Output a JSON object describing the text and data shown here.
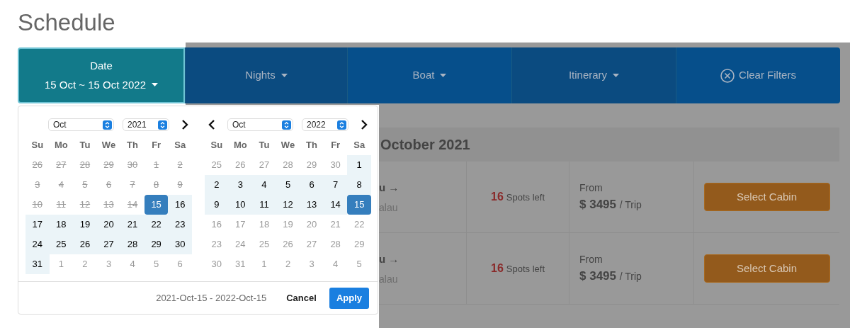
{
  "page_title": "Schedule",
  "filters": [
    {
      "kind": "date",
      "label": "Date",
      "value": "15 Oct ~ 15 Oct 2022",
      "selected": true
    },
    {
      "kind": "dropdown",
      "label": "Nights",
      "selected": false
    },
    {
      "kind": "dropdown",
      "label": "Boat",
      "selected": false
    },
    {
      "kind": "dropdown",
      "label": "Itinerary",
      "selected": false
    },
    {
      "kind": "clear",
      "label": "Clear Filters",
      "selected": false
    }
  ],
  "month_heading": "October 2021",
  "trips": [
    {
      "route_end": "u →",
      "port": "alau",
      "spots_count": "16",
      "spots_label": "Spots left",
      "from_label": "From",
      "price": "$ 3495",
      "price_unit": "/ Trip",
      "action": "Select Cabin"
    },
    {
      "route_end": "u →",
      "port": "alau",
      "spots_count": "16",
      "spots_label": "Spots left",
      "from_label": "From",
      "price": "$ 3495",
      "price_unit": "/ Trip",
      "action": "Select Cabin"
    }
  ],
  "calendars": [
    {
      "month": "Oct",
      "year": "2021",
      "prev": false,
      "next": true,
      "weekdays": [
        "Su",
        "Mo",
        "Tu",
        "We",
        "Th",
        "Fr",
        "Sa"
      ],
      "days": [
        {
          "day": "26",
          "kind": "disabled"
        },
        {
          "day": "27",
          "kind": "disabled"
        },
        {
          "day": "28",
          "kind": "disabled"
        },
        {
          "day": "29",
          "kind": "disabled"
        },
        {
          "day": "30",
          "kind": "disabled"
        },
        {
          "day": "1",
          "kind": "disabled"
        },
        {
          "day": "2",
          "kind": "disabled"
        },
        {
          "day": "3",
          "kind": "disabled"
        },
        {
          "day": "4",
          "kind": "disabled"
        },
        {
          "day": "5",
          "kind": "disabled"
        },
        {
          "day": "6",
          "kind": "disabled"
        },
        {
          "day": "7",
          "kind": "disabled"
        },
        {
          "day": "8",
          "kind": "disabled"
        },
        {
          "day": "9",
          "kind": "disabled"
        },
        {
          "day": "10",
          "kind": "disabled"
        },
        {
          "day": "11",
          "kind": "disabled"
        },
        {
          "day": "12",
          "kind": "disabled"
        },
        {
          "day": "13",
          "kind": "disabled"
        },
        {
          "day": "14",
          "kind": "disabled"
        },
        {
          "day": "15",
          "kind": "selected"
        },
        {
          "day": "16",
          "kind": "in_range"
        },
        {
          "day": "17",
          "kind": "in_range"
        },
        {
          "day": "18",
          "kind": "in_range"
        },
        {
          "day": "19",
          "kind": "in_range"
        },
        {
          "day": "20",
          "kind": "in_range"
        },
        {
          "day": "21",
          "kind": "in_range"
        },
        {
          "day": "22",
          "kind": "in_range"
        },
        {
          "day": "23",
          "kind": "in_range"
        },
        {
          "day": "24",
          "kind": "in_range"
        },
        {
          "day": "25",
          "kind": "in_range"
        },
        {
          "day": "26",
          "kind": "in_range"
        },
        {
          "day": "27",
          "kind": "in_range"
        },
        {
          "day": "28",
          "kind": "in_range"
        },
        {
          "day": "29",
          "kind": "in_range"
        },
        {
          "day": "30",
          "kind": "in_range"
        },
        {
          "day": "31",
          "kind": "in_range"
        },
        {
          "day": "1",
          "kind": "off"
        },
        {
          "day": "2",
          "kind": "off"
        },
        {
          "day": "3",
          "kind": "off"
        },
        {
          "day": "4",
          "kind": "off"
        },
        {
          "day": "5",
          "kind": "off"
        },
        {
          "day": "6",
          "kind": "off"
        }
      ]
    },
    {
      "month": "Oct",
      "year": "2022",
      "prev": true,
      "next": true,
      "weekdays": [
        "Su",
        "Mo",
        "Tu",
        "We",
        "Th",
        "Fr",
        "Sa"
      ],
      "days": [
        {
          "day": "25",
          "kind": "off"
        },
        {
          "day": "26",
          "kind": "off"
        },
        {
          "day": "27",
          "kind": "off"
        },
        {
          "day": "28",
          "kind": "off"
        },
        {
          "day": "29",
          "kind": "off"
        },
        {
          "day": "30",
          "kind": "off"
        },
        {
          "day": "1",
          "kind": "in_range"
        },
        {
          "day": "2",
          "kind": "in_range"
        },
        {
          "day": "3",
          "kind": "in_range"
        },
        {
          "day": "4",
          "kind": "in_range"
        },
        {
          "day": "5",
          "kind": "in_range"
        },
        {
          "day": "6",
          "kind": "in_range"
        },
        {
          "day": "7",
          "kind": "in_range"
        },
        {
          "day": "8",
          "kind": "in_range"
        },
        {
          "day": "9",
          "kind": "in_range"
        },
        {
          "day": "10",
          "kind": "in_range"
        },
        {
          "day": "11",
          "kind": "in_range"
        },
        {
          "day": "12",
          "kind": "in_range"
        },
        {
          "day": "13",
          "kind": "in_range"
        },
        {
          "day": "14",
          "kind": "in_range"
        },
        {
          "day": "15",
          "kind": "selected"
        },
        {
          "day": "16",
          "kind": "available"
        },
        {
          "day": "17",
          "kind": "available"
        },
        {
          "day": "18",
          "kind": "available"
        },
        {
          "day": "19",
          "kind": "available"
        },
        {
          "day": "20",
          "kind": "available"
        },
        {
          "day": "21",
          "kind": "available"
        },
        {
          "day": "22",
          "kind": "available"
        },
        {
          "day": "23",
          "kind": "available"
        },
        {
          "day": "24",
          "kind": "available"
        },
        {
          "day": "25",
          "kind": "available"
        },
        {
          "day": "26",
          "kind": "available"
        },
        {
          "day": "27",
          "kind": "available"
        },
        {
          "day": "28",
          "kind": "available"
        },
        {
          "day": "29",
          "kind": "available"
        },
        {
          "day": "30",
          "kind": "available"
        },
        {
          "day": "31",
          "kind": "available"
        },
        {
          "day": "1",
          "kind": "off"
        },
        {
          "day": "2",
          "kind": "off"
        },
        {
          "day": "3",
          "kind": "off"
        },
        {
          "day": "4",
          "kind": "off"
        },
        {
          "day": "5",
          "kind": "off"
        }
      ]
    }
  ],
  "range_text": "2021-Oct-15 - 2022-Oct-15",
  "cancel": "Cancel",
  "apply": "Apply"
}
